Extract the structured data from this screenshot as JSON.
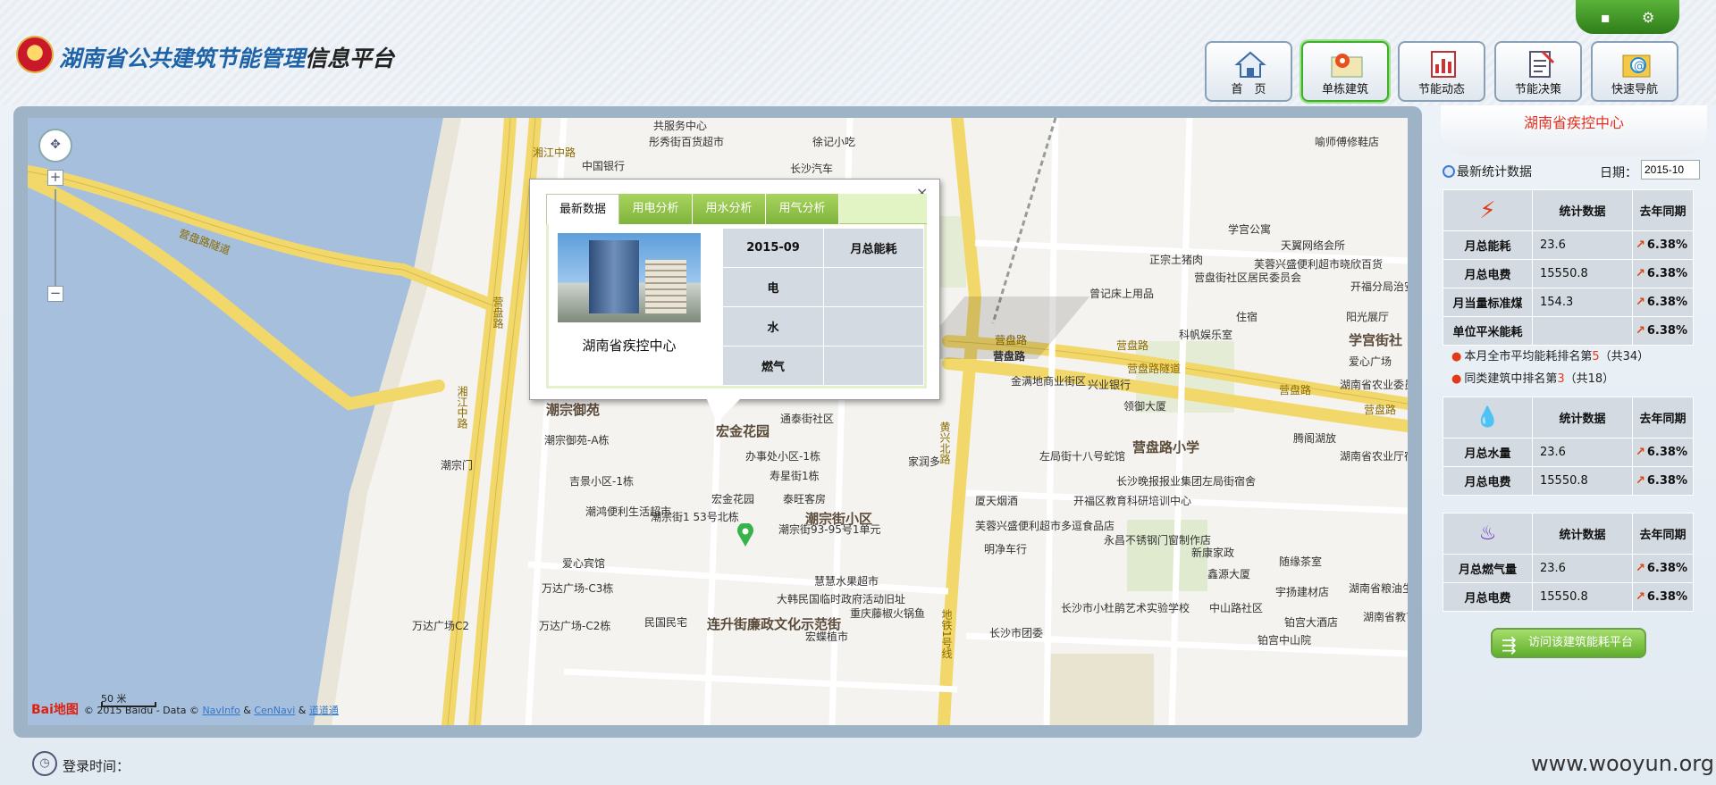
{
  "header": {
    "title_part1": "湖南省公共建筑节能管理",
    "title_part2": "信息平台",
    "nav": [
      {
        "label": "首　页",
        "icon": "home-icon"
      },
      {
        "label": "单栋建筑",
        "icon": "building-map-icon"
      },
      {
        "label": "节能动态",
        "icon": "calendar-chart-icon"
      },
      {
        "label": "节能决策",
        "icon": "clipboard-icon"
      },
      {
        "label": "快速导航",
        "icon": "at-folder-icon"
      }
    ]
  },
  "map": {
    "zoom_in": "+",
    "zoom_out": "−",
    "scale": "50 米",
    "copyright": "© 2015 Baidu - Data ©",
    "navinfo": "NavInfo",
    "amp1": "&",
    "cennavi": "CenNavi",
    "amp2": "&",
    "daodaotong": "道道通",
    "baidu_logo": "Bai地图",
    "labels": [
      {
        "text": "共服务中心"
      },
      {
        "text": "彤秀街百货超市"
      },
      {
        "text": "徐记小吃"
      },
      {
        "text": "湘江中路"
      },
      {
        "text": "中国银行"
      },
      {
        "text": "长沙汽车"
      },
      {
        "text": "喻师傅修鞋店"
      },
      {
        "text": "营盘路隧道"
      },
      {
        "text": "学宫公寓"
      },
      {
        "text": "天翼网络会所"
      },
      {
        "text": "正宗土猪肉"
      },
      {
        "text": "芙蓉兴盛便利超市晓欣百货"
      },
      {
        "text": "营盘街社区居民委员会"
      },
      {
        "text": "开福分局治安二队"
      },
      {
        "text": "曾记床上用品"
      },
      {
        "text": "住宿"
      },
      {
        "text": "阳光展厅"
      },
      {
        "text": "科帆娱乐室"
      },
      {
        "text": "学宫街社"
      },
      {
        "text": "营盘路"
      },
      {
        "text": "营盘路"
      },
      {
        "text": "营盘路"
      },
      {
        "text": "营盘路隧道"
      },
      {
        "text": "爱心广场"
      },
      {
        "text": "金满地商业街区"
      },
      {
        "text": "兴业银行"
      },
      {
        "text": "湖南省农业委员会"
      },
      {
        "text": "领御大厦"
      },
      {
        "text": "潮宗御苑"
      },
      {
        "text": "通泰街社区"
      },
      {
        "text": "宏金花园"
      },
      {
        "text": "潮宗御苑-A栋"
      },
      {
        "text": "办事处小区-1栋"
      },
      {
        "text": "寿星街1栋"
      },
      {
        "text": "营盘路小学"
      },
      {
        "text": "腾阁湖放"
      },
      {
        "text": "湖南省农业厅宿舍"
      },
      {
        "text": "左局街十八号蛇馆"
      },
      {
        "text": "长沙晚报报业集团左局街宿舍"
      },
      {
        "text": "家润多"
      },
      {
        "text": "潮宗门"
      },
      {
        "text": "吉景小区-1栋"
      },
      {
        "text": "宏金花园"
      },
      {
        "text": "泰旺客房"
      },
      {
        "text": "潮鸿便利生活超市"
      },
      {
        "text": "潮宗街1 53号北栋"
      },
      {
        "text": "潮宗街93-95号1单元"
      },
      {
        "text": "潮宗街小区"
      },
      {
        "text": "厦天烟酒"
      },
      {
        "text": "开福区教育科研培训中心"
      },
      {
        "text": "芙蓉兴盛便利超市多逗食品店"
      },
      {
        "text": "明净车行"
      },
      {
        "text": "永昌不锈钢门窗制作店"
      },
      {
        "text": "新康家政"
      },
      {
        "text": "随缘茶室"
      },
      {
        "text": "爱心宾馆"
      },
      {
        "text": "鑫源大厦"
      },
      {
        "text": "宇扬建材店"
      },
      {
        "text": "湖南省粮油生产局"
      },
      {
        "text": "万达广场-C3栋"
      },
      {
        "text": "慧慧水果超市"
      },
      {
        "text": "大韩民国临时政府活动旧址"
      },
      {
        "text": "长沙市小杜鹃艺术实验学校"
      },
      {
        "text": "中山路社区"
      },
      {
        "text": "湖南省教育厅西院"
      },
      {
        "text": "万达广场C2"
      },
      {
        "text": "万达广场-C2栋"
      },
      {
        "text": "民国民宅"
      },
      {
        "text": "连升街廉政文化示范街"
      },
      {
        "text": "重庆藤椒火锅鱼"
      },
      {
        "text": "长沙市团委"
      },
      {
        "text": "铂宫大酒店"
      },
      {
        "text": "宏蝶植市"
      },
      {
        "text": "铂宫中山院"
      },
      {
        "text": "黄兴北路"
      },
      {
        "text": "湘江中路"
      },
      {
        "text": "营盘路"
      },
      {
        "text": "营盘路"
      },
      {
        "text": "营盘路"
      },
      {
        "text": "地铁1号线"
      }
    ]
  },
  "popup": {
    "close": "×",
    "tabs": [
      "最新数据",
      "用电分析",
      "用水分析",
      "用气分析"
    ],
    "caption": "湖南省疾控中心",
    "table": [
      [
        "2015-09",
        "月总能耗"
      ],
      [
        "电",
        ""
      ],
      [
        "水",
        ""
      ],
      [
        "燃气",
        ""
      ]
    ]
  },
  "side": {
    "title": "湖南省疾控中心",
    "stat_label": "最新统计数据",
    "date_label": "日期：",
    "date_value": "2015-10",
    "col_stat": "统计数据",
    "col_yoy": "去年同期",
    "energy": [
      {
        "name": "月总能耗",
        "value": "23.6",
        "yoy": "6.38%"
      },
      {
        "name": "月总电费",
        "value": "15550.8",
        "yoy": "6.38%"
      },
      {
        "name": "月当量标准煤",
        "value": "154.3",
        "yoy": "6.38%"
      },
      {
        "name": "单位平米能耗",
        "value": "",
        "yoy": "6.38%"
      }
    ],
    "rank1_prefix": "本月全市平均能耗排名第",
    "rank1_num": "5",
    "rank1_suffix": "（共34）",
    "rank2_prefix": "同类建筑中排名第",
    "rank2_num": "3",
    "rank2_suffix": "（共18）",
    "water": [
      {
        "name": "月总水量",
        "value": "23.6",
        "yoy": "6.38%"
      },
      {
        "name": "月总电费",
        "value": "15550.8",
        "yoy": "6.38%"
      }
    ],
    "gas": [
      {
        "name": "月总燃气量",
        "value": "23.6",
        "yoy": "6.38%"
      },
      {
        "name": "月总电费",
        "value": "15550.8",
        "yoy": "6.38%"
      }
    ],
    "visit_button": "访问该建筑能耗平台"
  },
  "footer": {
    "login_label": "登录时间：",
    "watermark": "www.wooyun.org"
  }
}
